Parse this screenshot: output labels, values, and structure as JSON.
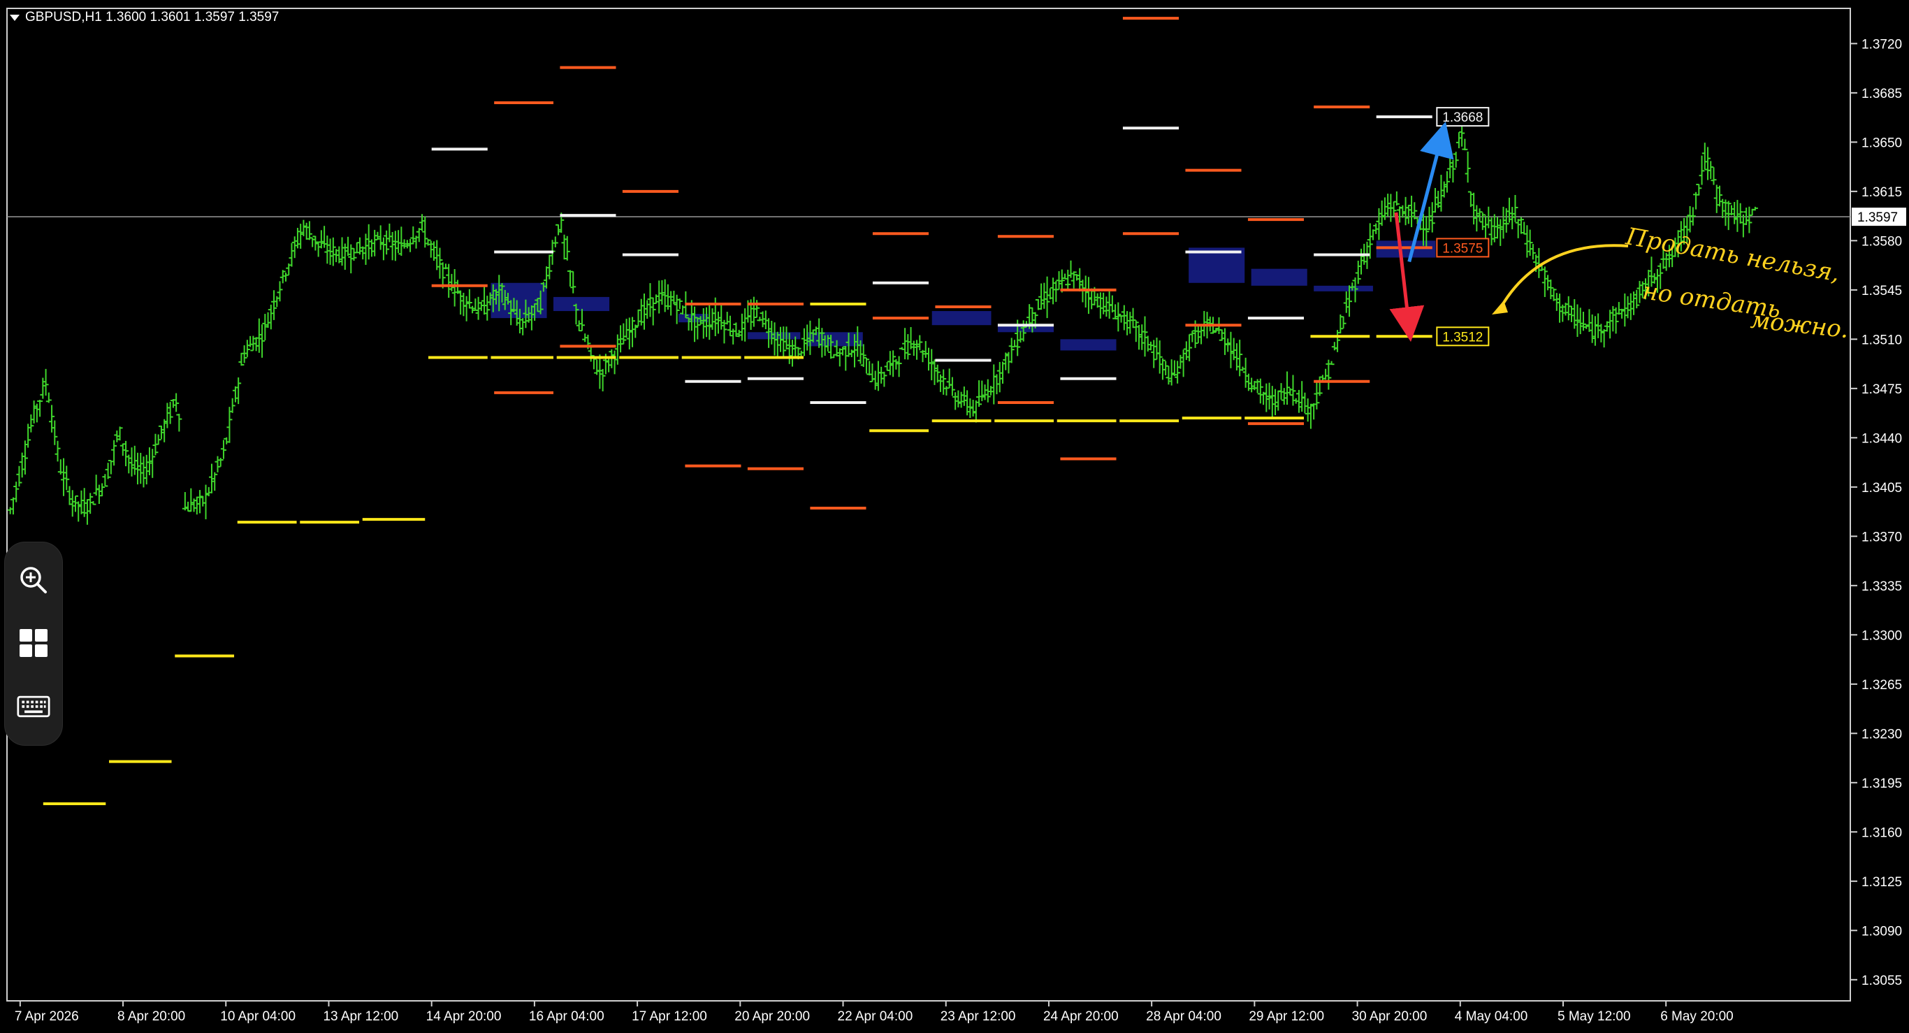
{
  "header": {
    "symbol_line": "GBPUSD,H1  1.3600 1.3601 1.3597 1.3597"
  },
  "colors": {
    "background": "#000000",
    "candles": "#3fd62b",
    "level_white": "#f2f2f2",
    "level_orange": "#ff5a1f",
    "level_yellow": "#ffe81a",
    "zone_blue": "#141a78",
    "arrow_blue": "#2a8bf2",
    "arrow_red": "#f02a3a",
    "annotation": "#ffd21f",
    "axis_text": "#ffffff",
    "grid": "#d0d0d0"
  },
  "toolbar": {
    "icons": [
      "zoom-in-icon",
      "grid-icon",
      "keyboard-icon"
    ]
  },
  "annotation": {
    "lines": [
      "Продать нельзя,",
      "но отдать",
      "можно."
    ]
  },
  "chart_data": {
    "type": "candlestick",
    "title": "",
    "symbol": "GBPUSD",
    "timeframe": "H1",
    "ohlc_header": {
      "open": 1.36,
      "high": 1.3601,
      "low": 1.3597,
      "close": 1.3597
    },
    "current_price": "1.3597",
    "ylim": [
      1.304,
      1.3745
    ],
    "y_ticks": [
      "1.3720",
      "1.3685",
      "1.3650",
      "1.3615",
      "1.3580",
      "1.3545",
      "1.3510",
      "1.3475",
      "1.3440",
      "1.3405",
      "1.3370",
      "1.3335",
      "1.3300",
      "1.3265",
      "1.3230",
      "1.3195",
      "1.3160",
      "1.3125",
      "1.3090",
      "1.3055"
    ],
    "x_ticks": [
      "7 Apr 2026",
      "8 Apr 20:00",
      "10 Apr 04:00",
      "13 Apr 12:00",
      "14 Apr 20:00",
      "16 Apr 04:00",
      "17 Apr 12:00",
      "20 Apr 20:00",
      "22 Apr 04:00",
      "23 Apr 12:00",
      "24 Apr 20:00",
      "28 Apr 04:00",
      "29 Apr 12:00",
      "30 Apr 20:00",
      "4 May 04:00",
      "5 May 12:00",
      "6 May 20:00"
    ],
    "price_path": [
      [
        0,
        1.338
      ],
      [
        0.02,
        1.3415
      ],
      [
        0.04,
        1.3455
      ],
      [
        0.06,
        1.348
      ],
      [
        0.08,
        1.342
      ],
      [
        0.1,
        1.3395
      ],
      [
        0.12,
        1.339
      ],
      [
        0.15,
        1.341
      ],
      [
        0.17,
        1.3445
      ],
      [
        0.19,
        1.342
      ],
      [
        0.21,
        1.3415
      ],
      [
        0.24,
        1.345
      ],
      [
        0.26,
        1.347
      ],
      [
        0.27,
        1.339
      ],
      [
        0.3,
        1.3395
      ],
      [
        0.33,
        1.343
      ],
      [
        0.36,
        1.35
      ],
      [
        0.39,
        1.3515
      ],
      [
        0.42,
        1.3555
      ],
      [
        0.45,
        1.359
      ],
      [
        0.48,
        1.3575
      ],
      [
        0.51,
        1.357
      ],
      [
        0.54,
        1.3575
      ],
      [
        0.57,
        1.358
      ],
      [
        0.6,
        1.3575
      ],
      [
        0.63,
        1.359
      ],
      [
        0.66,
        1.356
      ],
      [
        0.69,
        1.354
      ],
      [
        0.72,
        1.353
      ],
      [
        0.75,
        1.3545
      ],
      [
        0.78,
        1.352
      ],
      [
        0.81,
        1.3535
      ],
      [
        0.84,
        1.3595
      ],
      [
        0.87,
        1.352
      ],
      [
        0.9,
        1.3485
      ],
      [
        0.93,
        1.3505
      ],
      [
        0.96,
        1.3525
      ],
      [
        0.99,
        1.354
      ],
      [
        1.02,
        1.3535
      ],
      [
        1.05,
        1.352
      ],
      [
        1.08,
        1.3525
      ],
      [
        1.11,
        1.3515
      ],
      [
        1.14,
        1.353
      ],
      [
        1.17,
        1.351
      ],
      [
        1.2,
        1.35
      ],
      [
        1.23,
        1.3515
      ],
      [
        1.26,
        1.35
      ],
      [
        1.29,
        1.3505
      ],
      [
        1.32,
        1.348
      ],
      [
        1.35,
        1.3495
      ],
      [
        1.38,
        1.351
      ],
      [
        1.41,
        1.349
      ],
      [
        1.44,
        1.347
      ],
      [
        1.47,
        1.346
      ],
      [
        1.5,
        1.348
      ],
      [
        1.53,
        1.3505
      ],
      [
        1.56,
        1.353
      ],
      [
        1.59,
        1.3545
      ],
      [
        1.62,
        1.3555
      ],
      [
        1.65,
        1.354
      ],
      [
        1.68,
        1.353
      ],
      [
        1.71,
        1.352
      ],
      [
        1.74,
        1.3505
      ],
      [
        1.77,
        1.348
      ],
      [
        1.8,
        1.351
      ],
      [
        1.83,
        1.352
      ],
      [
        1.86,
        1.3505
      ],
      [
        1.89,
        1.348
      ],
      [
        1.92,
        1.3465
      ],
      [
        1.95,
        1.3475
      ],
      [
        1.98,
        1.346
      ],
      [
        2.01,
        1.349
      ],
      [
        2.04,
        1.354
      ],
      [
        2.07,
        1.358
      ],
      [
        2.1,
        1.3605
      ],
      [
        2.13,
        1.36
      ],
      [
        2.16,
        1.359
      ],
      [
        2.19,
        1.3625
      ],
      [
        2.21,
        1.3655
      ],
      [
        2.23,
        1.36
      ],
      [
        2.26,
        1.3585
      ],
      [
        2.29,
        1.36
      ],
      [
        2.32,
        1.357
      ],
      [
        2.35,
        1.354
      ],
      [
        2.38,
        1.3525
      ],
      [
        2.41,
        1.3515
      ],
      [
        2.44,
        1.3525
      ],
      [
        2.47,
        1.3535
      ],
      [
        2.5,
        1.3555
      ],
      [
        2.53,
        1.357
      ],
      [
        2.56,
        1.36
      ],
      [
        2.58,
        1.364
      ],
      [
        2.6,
        1.361
      ],
      [
        2.63,
        1.3595
      ],
      [
        2.66,
        1.36
      ]
    ],
    "levels": [
      {
        "color": "level_yellow",
        "price": 1.318,
        "x0": 0.055,
        "x1": 0.15
      },
      {
        "color": "level_yellow",
        "price": 1.321,
        "x0": 0.155,
        "x1": 0.25
      },
      {
        "color": "level_yellow",
        "price": 1.3285,
        "x0": 0.255,
        "x1": 0.345
      },
      {
        "color": "level_yellow",
        "price": 1.338,
        "x0": 0.35,
        "x1": 0.44
      },
      {
        "color": "level_yellow",
        "price": 1.338,
        "x0": 0.445,
        "x1": 0.535
      },
      {
        "color": "level_yellow",
        "price": 1.3382,
        "x0": 0.54,
        "x1": 0.635
      },
      {
        "color": "level_white",
        "price": 1.3645,
        "x0": 0.645,
        "x1": 0.73
      },
      {
        "color": "level_orange",
        "price": 1.3548,
        "x0": 0.645,
        "x1": 0.73
      },
      {
        "color": "level_yellow",
        "price": 1.3497,
        "x0": 0.64,
        "x1": 0.73
      },
      {
        "color": "level_orange",
        "price": 1.3678,
        "x0": 0.74,
        "x1": 0.83
      },
      {
        "color": "level_white",
        "price": 1.3572,
        "x0": 0.74,
        "x1": 0.83
      },
      {
        "color": "level_orange",
        "price": 1.3472,
        "x0": 0.74,
        "x1": 0.83
      },
      {
        "color": "level_yellow",
        "price": 1.3497,
        "x0": 0.735,
        "x1": 0.83
      },
      {
        "color": "level_orange",
        "price": 1.3703,
        "x0": 0.84,
        "x1": 0.925
      },
      {
        "color": "level_white",
        "price": 1.3598,
        "x0": 0.84,
        "x1": 0.925
      },
      {
        "color": "level_orange",
        "price": 1.3505,
        "x0": 0.84,
        "x1": 0.925
      },
      {
        "color": "level_yellow",
        "price": 1.3497,
        "x0": 0.835,
        "x1": 0.925
      },
      {
        "color": "level_orange",
        "price": 1.3615,
        "x0": 0.935,
        "x1": 1.02
      },
      {
        "color": "level_white",
        "price": 1.357,
        "x0": 0.935,
        "x1": 1.02
      },
      {
        "color": "level_yellow",
        "price": 1.3497,
        "x0": 0.93,
        "x1": 1.02
      },
      {
        "color": "level_orange",
        "price": 1.3535,
        "x0": 1.03,
        "x1": 1.115
      },
      {
        "color": "level_white",
        "price": 1.348,
        "x0": 1.03,
        "x1": 1.115
      },
      {
        "color": "level_yellow",
        "price": 1.3497,
        "x0": 1.025,
        "x1": 1.115
      },
      {
        "color": "level_orange",
        "price": 1.342,
        "x0": 1.03,
        "x1": 1.115
      },
      {
        "color": "level_orange",
        "price": 1.3535,
        "x0": 1.125,
        "x1": 1.21
      },
      {
        "color": "level_white",
        "price": 1.3482,
        "x0": 1.125,
        "x1": 1.21
      },
      {
        "color": "level_yellow",
        "price": 1.3497,
        "x0": 1.12,
        "x1": 1.21
      },
      {
        "color": "level_orange",
        "price": 1.3418,
        "x0": 1.125,
        "x1": 1.21
      },
      {
        "color": "level_yellow",
        "price": 1.3535,
        "x0": 1.22,
        "x1": 1.305
      },
      {
        "color": "level_white",
        "price": 1.3465,
        "x0": 1.22,
        "x1": 1.305
      },
      {
        "color": "level_orange",
        "price": 1.339,
        "x0": 1.22,
        "x1": 1.305
      },
      {
        "color": "level_orange",
        "price": 1.3585,
        "x0": 1.315,
        "x1": 1.4
      },
      {
        "color": "level_white",
        "price": 1.355,
        "x0": 1.315,
        "x1": 1.4
      },
      {
        "color": "level_orange",
        "price": 1.3525,
        "x0": 1.315,
        "x1": 1.4
      },
      {
        "color": "level_yellow",
        "price": 1.3445,
        "x0": 1.31,
        "x1": 1.4
      },
      {
        "color": "level_orange",
        "price": 1.3533,
        "x0": 1.41,
        "x1": 1.495
      },
      {
        "color": "level_white",
        "price": 1.3495,
        "x0": 1.41,
        "x1": 1.495
      },
      {
        "color": "level_yellow",
        "price": 1.3452,
        "x0": 1.405,
        "x1": 1.495
      },
      {
        "color": "level_orange",
        "price": 1.3583,
        "x0": 1.505,
        "x1": 1.59
      },
      {
        "color": "level_white",
        "price": 1.352,
        "x0": 1.505,
        "x1": 1.59
      },
      {
        "color": "level_orange",
        "price": 1.3465,
        "x0": 1.505,
        "x1": 1.59
      },
      {
        "color": "level_yellow",
        "price": 1.3452,
        "x0": 1.5,
        "x1": 1.59
      },
      {
        "color": "level_orange",
        "price": 1.3545,
        "x0": 1.6,
        "x1": 1.685
      },
      {
        "color": "level_white",
        "price": 1.3482,
        "x0": 1.6,
        "x1": 1.685
      },
      {
        "color": "level_orange",
        "price": 1.3425,
        "x0": 1.6,
        "x1": 1.685
      },
      {
        "color": "level_yellow",
        "price": 1.3452,
        "x0": 1.595,
        "x1": 1.685
      },
      {
        "color": "level_orange",
        "price": 1.3738,
        "x0": 1.695,
        "x1": 1.78
      },
      {
        "color": "level_white",
        "price": 1.366,
        "x0": 1.695,
        "x1": 1.78
      },
      {
        "color": "level_orange",
        "price": 1.3585,
        "x0": 1.695,
        "x1": 1.78
      },
      {
        "color": "level_yellow",
        "price": 1.3452,
        "x0": 1.69,
        "x1": 1.78
      },
      {
        "color": "level_orange",
        "price": 1.363,
        "x0": 1.79,
        "x1": 1.875
      },
      {
        "color": "level_white",
        "price": 1.3572,
        "x0": 1.79,
        "x1": 1.875
      },
      {
        "color": "level_orange",
        "price": 1.352,
        "x0": 1.79,
        "x1": 1.875
      },
      {
        "color": "level_yellow",
        "price": 1.3454,
        "x0": 1.785,
        "x1": 1.875
      },
      {
        "color": "level_orange",
        "price": 1.3595,
        "x0": 1.885,
        "x1": 1.97
      },
      {
        "color": "level_white",
        "price": 1.3525,
        "x0": 1.885,
        "x1": 1.97
      },
      {
        "color": "level_orange",
        "price": 1.345,
        "x0": 1.885,
        "x1": 1.97
      },
      {
        "color": "level_yellow",
        "price": 1.3454,
        "x0": 1.88,
        "x1": 1.97
      },
      {
        "color": "level_orange",
        "price": 1.3675,
        "x0": 1.985,
        "x1": 2.07
      },
      {
        "color": "level_white",
        "price": 1.357,
        "x0": 1.985,
        "x1": 2.07
      },
      {
        "color": "level_yellow",
        "price": 1.3512,
        "x0": 1.98,
        "x1": 2.07
      },
      {
        "color": "level_orange",
        "price": 1.348,
        "x0": 1.985,
        "x1": 2.07
      },
      {
        "color": "level_white",
        "price": 1.3668,
        "x0": 2.08,
        "x1": 2.165
      },
      {
        "color": "level_orange",
        "price": 1.3575,
        "x0": 2.08,
        "x1": 2.165
      },
      {
        "color": "level_yellow",
        "price": 1.3512,
        "x0": 2.08,
        "x1": 2.165
      }
    ],
    "zones": [
      {
        "x0": 0.735,
        "x1": 0.82,
        "y0": 1.355,
        "y1": 1.3525
      },
      {
        "x0": 0.83,
        "x1": 0.915,
        "y0": 1.354,
        "y1": 1.353
      },
      {
        "x0": 1.02,
        "x1": 1.065,
        "y0": 1.3528,
        "y1": 1.3522
      },
      {
        "x0": 1.125,
        "x1": 1.205,
        "y0": 1.3515,
        "y1": 1.351
      },
      {
        "x0": 1.215,
        "x1": 1.3,
        "y0": 1.3515,
        "y1": 1.3505
      },
      {
        "x0": 1.405,
        "x1": 1.495,
        "y0": 1.353,
        "y1": 1.352
      },
      {
        "x0": 1.505,
        "x1": 1.59,
        "y0": 1.352,
        "y1": 1.3515
      },
      {
        "x0": 1.6,
        "x1": 1.685,
        "y0": 1.351,
        "y1": 1.3502
      },
      {
        "x0": 1.795,
        "x1": 1.88,
        "y0": 1.3575,
        "y1": 1.355
      },
      {
        "x0": 1.89,
        "x1": 1.975,
        "y0": 1.356,
        "y1": 1.3548
      },
      {
        "x0": 1.985,
        "x1": 2.075,
        "y0": 1.3548,
        "y1": 1.3544
      },
      {
        "x0": 2.08,
        "x1": 2.17,
        "y0": 1.358,
        "y1": 1.3568
      }
    ],
    "price_labels": [
      {
        "text": "1.3668",
        "price": 1.3668,
        "color": "level_white"
      },
      {
        "text": "1.3575",
        "price": 1.3575,
        "color": "level_orange"
      },
      {
        "text": "1.3512",
        "price": 1.3512,
        "color": "level_yellow"
      }
    ],
    "arrows": [
      {
        "color": "arrow_blue",
        "from": [
          2.13,
          1.3565
        ],
        "to": [
          2.18,
          1.3655
        ]
      },
      {
        "color": "arrow_red",
        "from": [
          2.11,
          1.36
        ],
        "to": [
          2.13,
          1.3518
        ]
      }
    ]
  }
}
